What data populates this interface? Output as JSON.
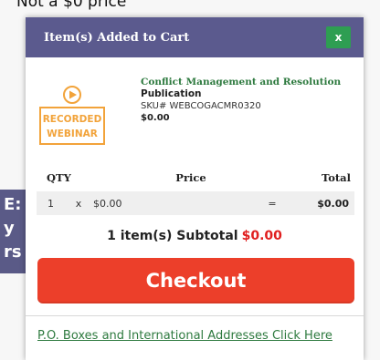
{
  "background": {
    "top_text": "Not a $0 price",
    "left_chars": [
      "E:",
      "y",
      "rs"
    ]
  },
  "modal": {
    "title": "Item(s) Added to Cart",
    "close_label": "x"
  },
  "product": {
    "thumb": {
      "icon": "play-circle-icon",
      "line1": "RECORDED",
      "line2": "WEBINAR",
      "color": "#f2a33a"
    },
    "name": "Conflict Management and Resolution",
    "type": "Publication",
    "sku": "SKU# WEBCOGACMR0320",
    "price": "$0.00"
  },
  "cart_table": {
    "headers": {
      "qty": "QTY",
      "price": "Price",
      "total": "Total"
    },
    "rows": [
      {
        "qty": "1",
        "times": "x",
        "price": "$0.00",
        "equals": "=",
        "total": "$0.00"
      }
    ]
  },
  "subtotal": {
    "label": "1 item(s) Subtotal",
    "amount": "$0.00"
  },
  "checkout": {
    "label": "Checkout"
  },
  "po_link": {
    "label": "P.O. Boxes and International Addresses Click Here"
  },
  "colors": {
    "header_bg": "#5b5a8e",
    "close_bg": "#2e9e52",
    "checkout_bg": "#ec3f2a",
    "link_green": "#2e7a3f",
    "subtotal_red": "#e02020"
  }
}
